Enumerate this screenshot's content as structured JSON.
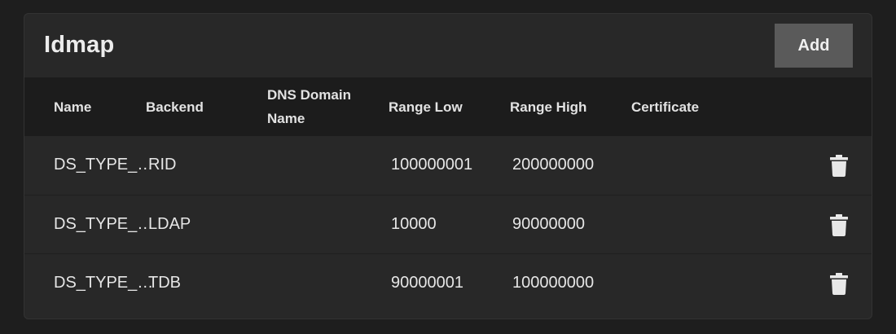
{
  "card": {
    "title": "Idmap",
    "add_label": "Add"
  },
  "table": {
    "headers": {
      "name": "Name",
      "backend": "Backend",
      "dns_line1": "DNS Domain",
      "dns_line2": "Name",
      "range_low": "Range Low",
      "range_high": "Range High",
      "certificate": "Certificate"
    },
    "rows": [
      {
        "name": "DS_TYPE_…",
        "backend": "RID",
        "dns_domain": "",
        "range_low": "100000001",
        "range_high": "200000000",
        "certificate": ""
      },
      {
        "name": "DS_TYPE_…",
        "backend": "LDAP",
        "dns_domain": "",
        "range_low": "10000",
        "range_high": "90000000",
        "certificate": ""
      },
      {
        "name": "DS_TYPE_…",
        "backend": "TDB",
        "dns_domain": "",
        "range_low": "90000001",
        "range_high": "100000000",
        "certificate": ""
      }
    ]
  },
  "icons": {
    "delete": "trash-icon"
  },
  "colors": {
    "background": "#1e1e1e",
    "card": "#282828",
    "header_row": "#1c1c1c",
    "button": "#5a5a5a"
  }
}
